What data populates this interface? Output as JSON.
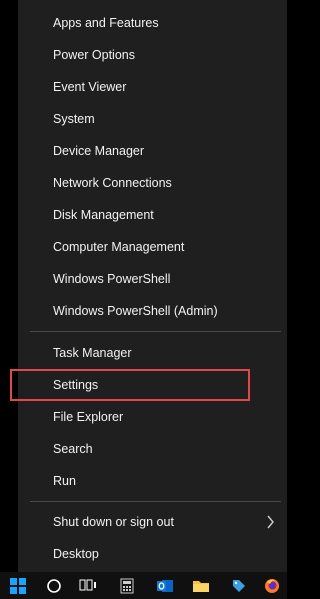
{
  "menu": {
    "items": [
      {
        "label": "Apps and Features"
      },
      {
        "label": "Power Options"
      },
      {
        "label": "Event Viewer"
      },
      {
        "label": "System"
      },
      {
        "label": "Device Manager"
      },
      {
        "label": "Network Connections"
      },
      {
        "label": "Disk Management"
      },
      {
        "label": "Computer Management"
      },
      {
        "label": "Windows PowerShell"
      },
      {
        "label": "Windows PowerShell (Admin)"
      },
      {
        "label": "Task Manager"
      },
      {
        "label": "Settings"
      },
      {
        "label": "File Explorer"
      },
      {
        "label": "Search"
      },
      {
        "label": "Run"
      },
      {
        "label": "Shut down or sign out"
      },
      {
        "label": "Desktop"
      }
    ],
    "highlighted": "Settings",
    "highlight_color": "#e0484b",
    "submenu_chevron": "chevron-right-icon"
  },
  "taskbar": {
    "icons": [
      "windows-start-icon",
      "cortana-icon",
      "task-view-icon",
      "calculator-icon",
      "outlook-icon",
      "file-explorer-icon",
      "tag-app-icon",
      "firefox-icon"
    ]
  }
}
